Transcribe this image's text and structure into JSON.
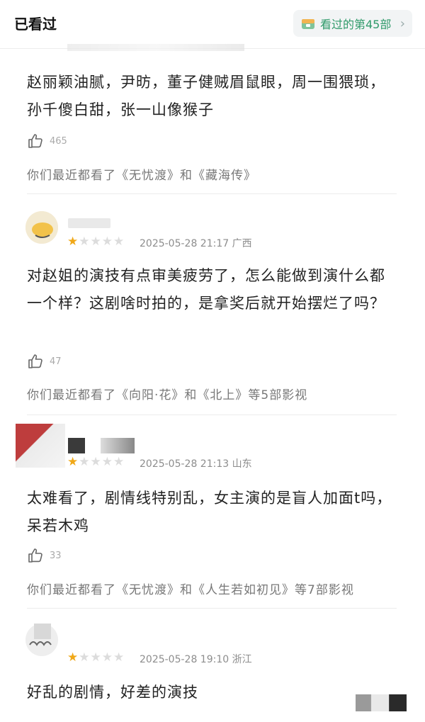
{
  "header": {
    "title": "已看过",
    "watched_label": "看过的第45部",
    "chevron": "›"
  },
  "comments": [
    {
      "text": "赵丽颖油腻，尹昉，董子健贼眉鼠眼，周一围猥琐，孙千傻白甜，张一山像猴子",
      "likes": "465",
      "recent": "你们最近都看了《无忧渡》和《藏海传》"
    },
    {
      "rating": 1,
      "date": "2025-05-28 21:17",
      "region": "广西",
      "text": "对赵姐的演技有点审美疲劳了，怎么能做到演什么都一个样？这剧啥时拍的，是拿奖后就开始摆烂了吗？",
      "likes": "47",
      "recent": "你们最近都看了《向阳·花》和《北上》等5部影视"
    },
    {
      "rating": 1,
      "date": "2025-05-28 21:13",
      "region": "山东",
      "text": "太难看了，剧情线特别乱，女主演的是盲人加面t吗，呆若木鸡",
      "likes": "33",
      "recent": "你们最近都看了《无忧渡》和《人生若如初见》等7部影视"
    },
    {
      "rating": 1,
      "date": "2025-05-28 19:10",
      "region": "浙江",
      "text": "好乱的剧情，好差的演技"
    }
  ]
}
